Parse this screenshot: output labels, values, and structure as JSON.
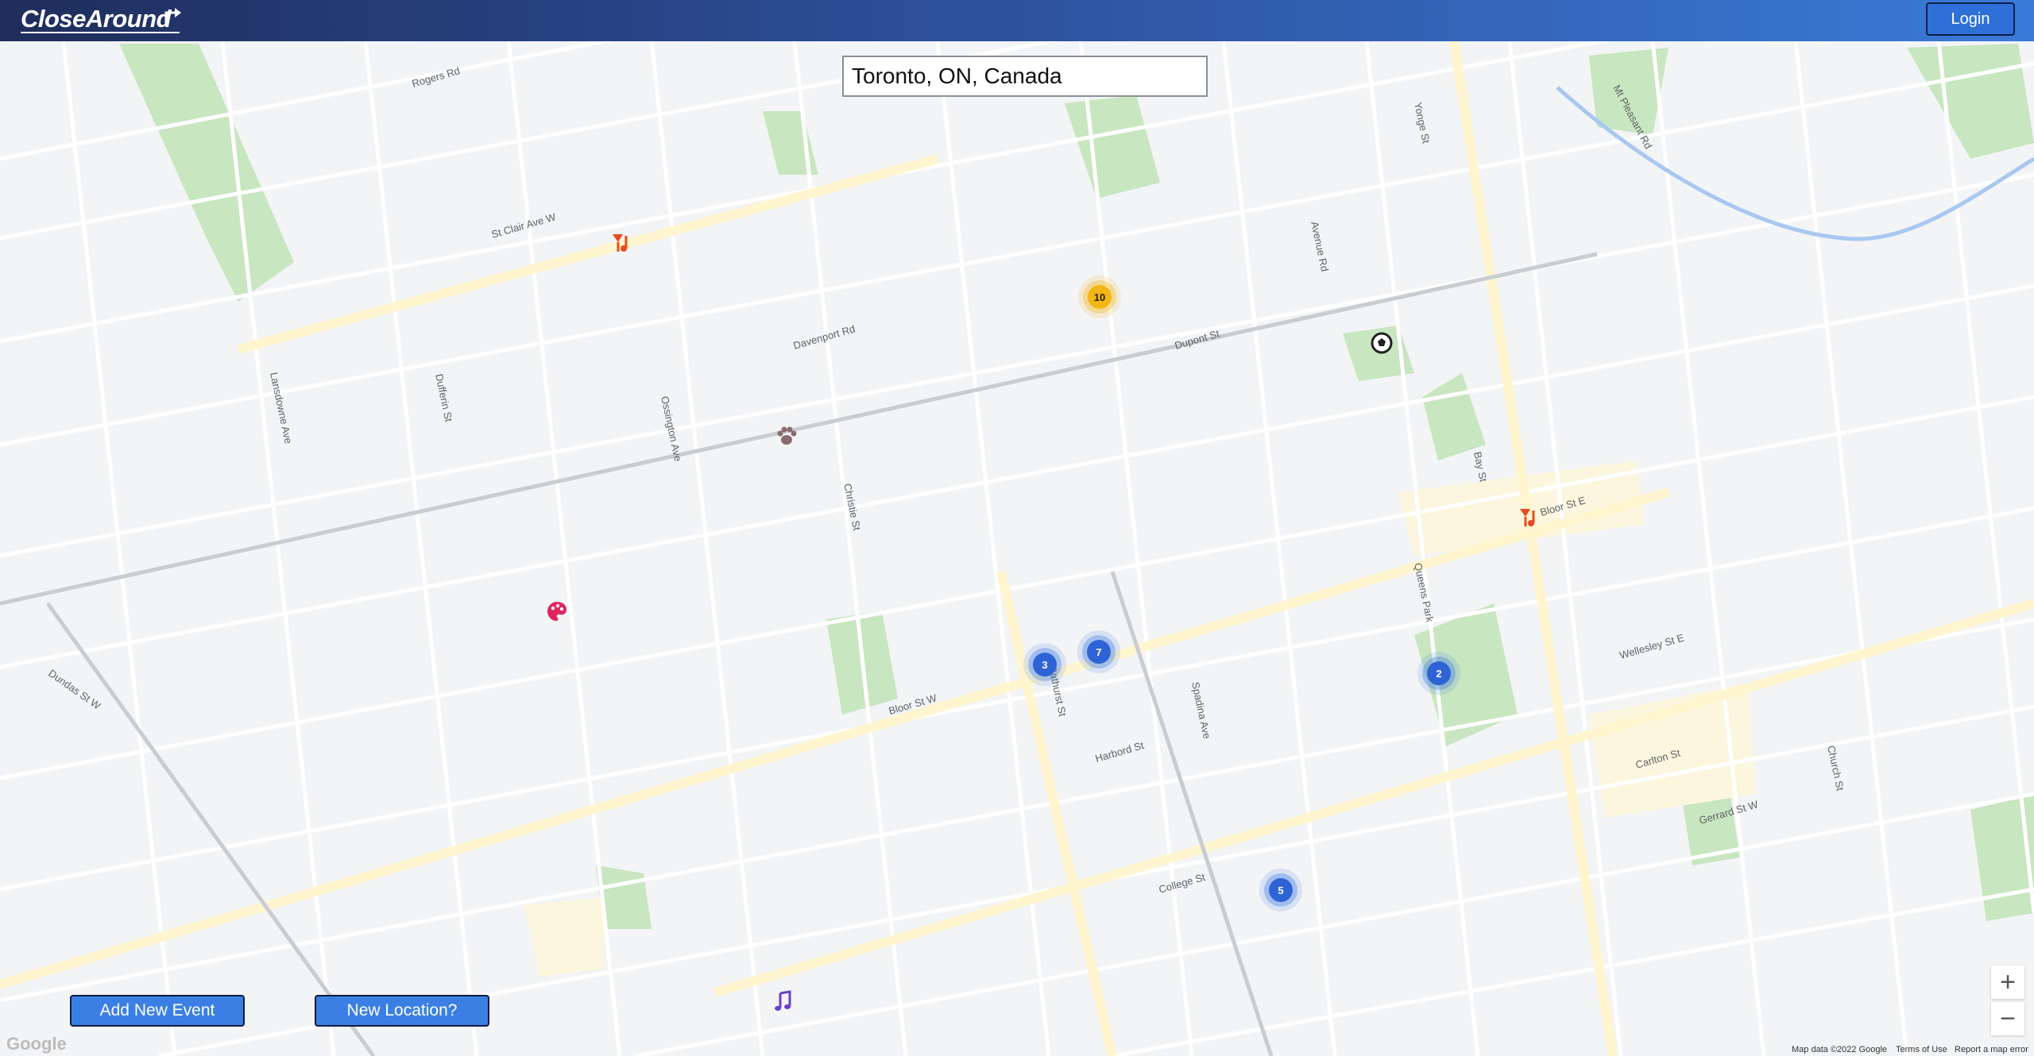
{
  "header": {
    "logo": "CloseAround",
    "login_label": "Login"
  },
  "search": {
    "value": "Toronto, ON, Canada"
  },
  "actions": {
    "add_event_label": "Add New Event",
    "new_location_label": "New Location?"
  },
  "zoom": {
    "in_label": "+",
    "out_label": "−"
  },
  "map": {
    "clusters": [
      {
        "count": "10",
        "color": "#f2b616"
      },
      {
        "count": "3",
        "color": "#2e63d6"
      },
      {
        "count": "7",
        "color": "#2e63d6"
      },
      {
        "count": "2",
        "color": "#2e63d6"
      },
      {
        "count": "5",
        "color": "#2e63d6"
      }
    ],
    "markers": [
      {
        "icon": "music-stand-icon"
      },
      {
        "icon": "music-stand-icon"
      },
      {
        "icon": "soccer-ball-icon"
      },
      {
        "icon": "paw-icon"
      },
      {
        "icon": "palette-icon"
      },
      {
        "icon": "music-note-icon"
      }
    ],
    "streets": [
      "St Clair Ave W",
      "Davenport Rd",
      "Dupont St",
      "Bloor St W",
      "Bloor St E",
      "College St",
      "Dundas St W",
      "Harbord St",
      "Bathurst St",
      "Spadina Ave",
      "Dufferin St",
      "Ossington Ave",
      "Christie St",
      "Yonge St",
      "Avenue Rd",
      "Mt Pleasant Rd",
      "Lansdowne Ave",
      "Church St",
      "Rogers Rd",
      "Bay St",
      "Queens Park",
      "Carlton St",
      "Gerrard St W",
      "Wellesley St E"
    ],
    "footer": {
      "google": "Google",
      "map_data": "Map data ©2022 Google",
      "terms": "Terms of Use",
      "report": "Report a map error"
    }
  }
}
